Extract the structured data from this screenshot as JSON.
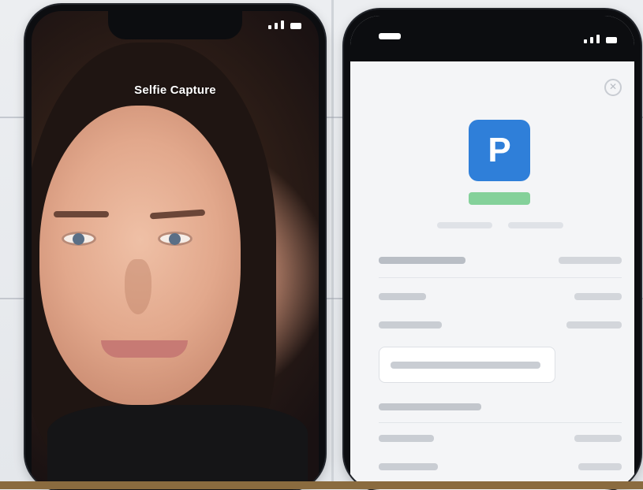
{
  "phones": {
    "left": {
      "camera_title": "Selfie Capture"
    },
    "right": {
      "app_logo_letter": "P"
    }
  },
  "colors": {
    "logo_blue": "#2f7fd9",
    "verified_green": "#84d19a",
    "background": "#e9ebee"
  },
  "icons": {
    "signal": "signal-icon",
    "close": "close-icon"
  }
}
